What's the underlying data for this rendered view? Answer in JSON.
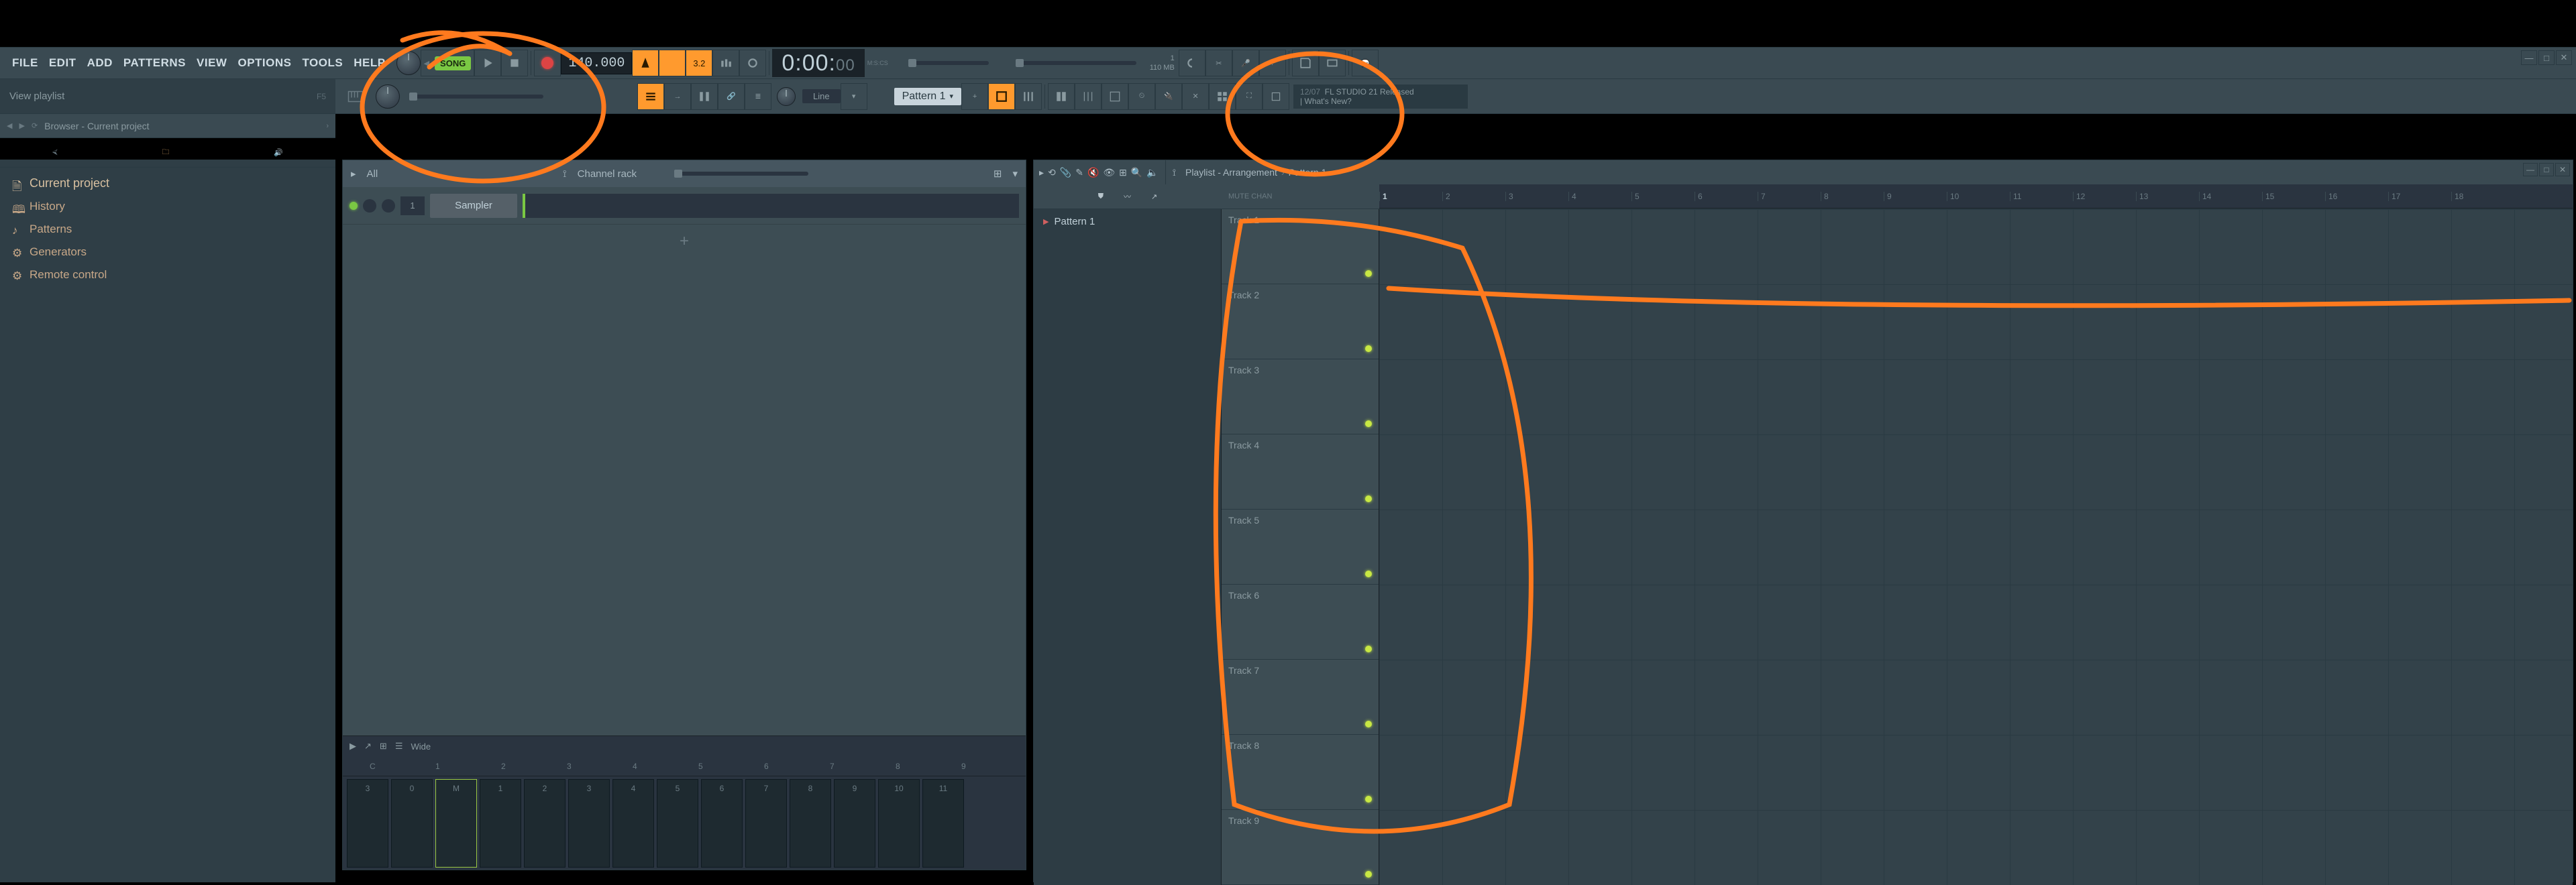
{
  "menu": {
    "items": [
      "FILE",
      "EDIT",
      "ADD",
      "PATTERNS",
      "VIEW",
      "OPTIONS",
      "TOOLS",
      "HELP"
    ]
  },
  "transport": {
    "mode": "SONG",
    "tempo": "140.000",
    "fine": "3.2",
    "time_main": "0:00:",
    "time_ms": "00",
    "time_unit_top": "M:S:CS",
    "time_unit_bot": "",
    "cpu": "1",
    "mem": "110 MB"
  },
  "toolbar2": {
    "hint": "View playlist",
    "hint_key": "F5",
    "snap": "Line",
    "pattern": "Pattern 1",
    "news_date": "12/07",
    "news_head": "FL STUDIO 21 Released",
    "news_sub": "| What's New?"
  },
  "browser": {
    "title": "Browser - Current project",
    "filter": "All",
    "root": "Current project",
    "items": [
      "History",
      "Patterns",
      "Generators",
      "Remote control"
    ]
  },
  "chanrack": {
    "title": "Channel rack",
    "chan_num": "1",
    "chan_name": "Sampler",
    "piano_label": "Wide",
    "octaves": [
      "C",
      "1",
      "2",
      "3",
      "4",
      "5",
      "6",
      "7",
      "8",
      "9"
    ],
    "mix_label": "M",
    "slots": [
      "3",
      "0",
      "1",
      "2",
      "3",
      "4",
      "5",
      "6",
      "7",
      "8",
      "9",
      "10",
      "11"
    ]
  },
  "playlist": {
    "title": "Playlist - Arrangement",
    "crumb": "Pattern 1",
    "pattern_item": "Pattern 1",
    "ruler_labels": [
      "MUTE  CHAN"
    ],
    "bars": [
      "1",
      "2",
      "3",
      "4",
      "5",
      "6",
      "7",
      "8",
      "9",
      "10",
      "11",
      "12",
      "13",
      "14",
      "15",
      "16",
      "17",
      "18"
    ],
    "tracks": [
      "Track 1",
      "Track 2",
      "Track 3",
      "Track 4",
      "Track 5",
      "Track 6",
      "Track 7",
      "Track 8",
      "Track 9"
    ]
  }
}
